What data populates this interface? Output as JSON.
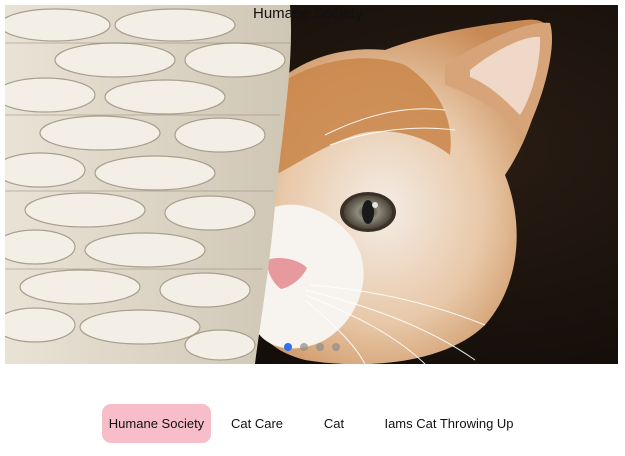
{
  "carousel": {
    "caption": "Humane Society",
    "slide_count": 4,
    "active_slide": 1
  },
  "tabs": [
    {
      "label": "Humane Society",
      "selected": true
    },
    {
      "label": "Cat Care",
      "selected": false
    },
    {
      "label": "Cat",
      "selected": false
    },
    {
      "label": "Iams Cat Throwing Up",
      "selected": false
    }
  ],
  "colors": {
    "active_dot": "#2f6ff0",
    "selected_tab_bg": "#f7bdc9"
  }
}
